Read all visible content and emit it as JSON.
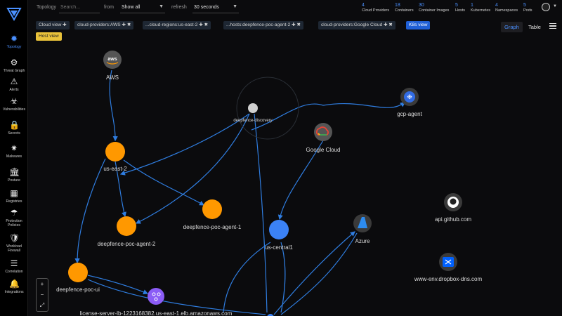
{
  "nav": {
    "items": [
      {
        "label": "Topology",
        "icon": "topology-icon"
      },
      {
        "label": "Threat Graph",
        "icon": "threat-graph-icon"
      },
      {
        "label": "Alerts",
        "icon": "alerts-icon"
      },
      {
        "label": "Vulnerabilities",
        "icon": "vulnerabilities-icon"
      },
      {
        "label": "Secrets",
        "icon": "secrets-icon"
      },
      {
        "label": "Malwares",
        "icon": "malwares-icon"
      },
      {
        "label": "Posture",
        "icon": "posture-icon"
      },
      {
        "label": "Registries",
        "icon": "registries-icon"
      },
      {
        "label": "Protection Policies",
        "icon": "protection-policies-icon"
      },
      {
        "label": "Workload Firewall",
        "icon": "workload-firewall-icon"
      },
      {
        "label": "Correlation",
        "icon": "correlation-icon"
      },
      {
        "label": "Integrations",
        "icon": "integrations-icon"
      }
    ]
  },
  "topbar": {
    "topology_label": "Topology",
    "search_placeholder": "Search...",
    "from_label": "from",
    "from_value": "Show all",
    "refresh_label": "refresh",
    "refresh_value": "30 seconds"
  },
  "stats": [
    {
      "value": "4",
      "caption": "Cloud Providers"
    },
    {
      "value": "18",
      "caption": "Containers"
    },
    {
      "value": "30",
      "caption": "Container Images"
    },
    {
      "value": "5",
      "caption": "Hosts"
    },
    {
      "value": "1",
      "caption": "Kubernetes"
    },
    {
      "value": "4",
      "caption": "Namespaces"
    },
    {
      "value": "5",
      "caption": "Pods"
    }
  ],
  "filters": {
    "chips": [
      "Cloud view ✚",
      "cloud-providers:AWS ✚ ✖",
      "...cloud-regions:us-east-2 ✚ ✖",
      "...hosts:deepfence-poc-agent-2 ✚ ✖",
      "cloud-providers:Google Cloud ✚ ✖"
    ],
    "k8s_view": "K8s view",
    "host_view": "Host view"
  },
  "views": {
    "graph": "Graph",
    "table": "Table"
  },
  "graph": {
    "nodes": {
      "aws": "AWS",
      "discovery": "deepfence-discovery",
      "gcp_agent": "gcp-agent",
      "google_cloud": "Google Cloud",
      "us_east_2": "us-east-2",
      "agent_1": "deepfence-poc-agent-1",
      "agent_2": "deepfence-poc-agent-2",
      "us_central1": "us-central1",
      "azure": "Azure",
      "github": "api.github.com",
      "dropbox": "www-env.dropbox-dns.com",
      "poc_ui": "deepfence-poc-ui",
      "license_lb": "license-server-lb-1223168382.us-east-1.elb.amazonaws.com"
    },
    "colors": {
      "region": "#ff9800",
      "gcp_region": "#3b82f6",
      "edge": "#2f7de0",
      "lb": "#8b5cf6"
    }
  },
  "zoom": {
    "in": "+",
    "out": "−",
    "fit": "⤢"
  }
}
